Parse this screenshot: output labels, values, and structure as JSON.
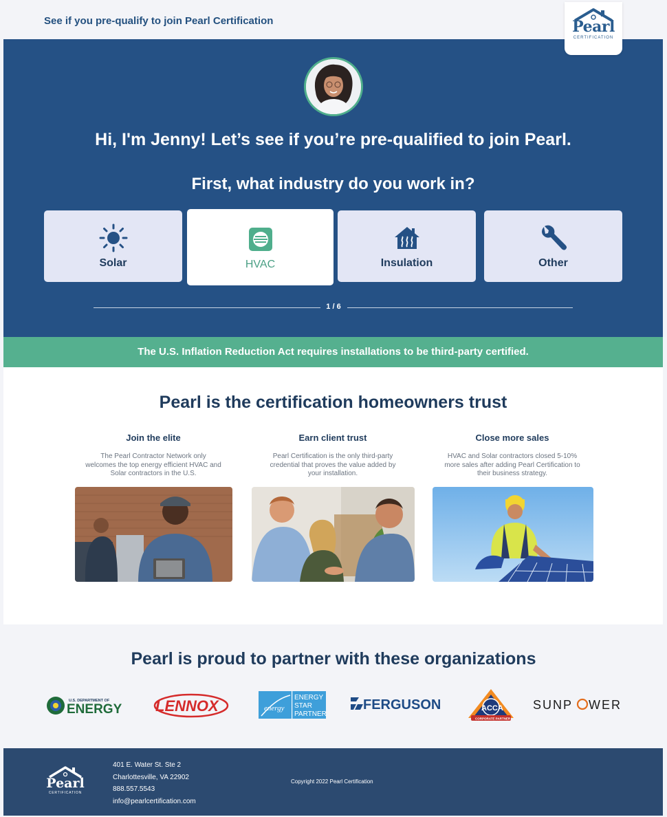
{
  "header": {
    "link_text": "See if you pre-qualify to join Pearl Certification",
    "logo_text": "Pearl",
    "logo_subtext": "CERTIFICATION"
  },
  "hero": {
    "title": "Hi, I'm Jenny! Let’s see if you’re pre-qualified to join Pearl.",
    "question": "First, what industry do you work in?",
    "options": [
      {
        "label": "Solar",
        "icon": "sun-icon",
        "selected": false
      },
      {
        "label": "HVAC",
        "icon": "hvac-unit-icon",
        "selected": true
      },
      {
        "label": "Insulation",
        "icon": "house-heat-icon",
        "selected": false
      },
      {
        "label": "Other",
        "icon": "wrench-icon",
        "selected": false
      }
    ],
    "progress_text": "1 / 6",
    "progress_fraction": 0.1667
  },
  "banner": {
    "text": "The U.S. Inflation Reduction Act requires installations to be third-party certified."
  },
  "trust": {
    "title": "Pearl is the certification homeowners trust",
    "columns": [
      {
        "heading": "Join the elite",
        "body": "The Pearl Contractor Network only welcomes the top energy efficient HVAC and Solar contractors in the U.S."
      },
      {
        "heading": "Earn client trust",
        "body": "Pearl Certification is the only third-party credential that proves the value added by your installation."
      },
      {
        "heading": "Close more sales",
        "body": "HVAC and Solar contractors closed 5-10% more sales after adding Pearl Certification to their business strategy."
      }
    ]
  },
  "partners": {
    "title": "Pearl is proud to partner with these organizations",
    "logos": {
      "doe_small": "U.S. DEPARTMENT OF",
      "doe_big": "ENERGY",
      "lennox": "LENNOX",
      "energystar_1": "ENERGY",
      "energystar_2": "STAR",
      "energystar_3": "PARTNER",
      "ferguson": "FERGUSON",
      "acca": "ACCA",
      "acca_sub": "CORPORATE PARTNER",
      "sunpower_1": "SUNP",
      "sunpower_2": "WER"
    }
  },
  "footer": {
    "logo_text": "Pearl",
    "logo_subtext": "CERTIFICATION",
    "address_1": "401 E. Water St. Ste 2",
    "address_2": "Charlottesville, VA 22902",
    "phone": "888.557.5543",
    "email": "info@pearlcertification.com",
    "copyright": "Copyright 2022 Pearl Certification"
  },
  "colors": {
    "navy": "#255185",
    "green": "#55b08f",
    "footer": "#2c4a70",
    "card": "#e3e6f5"
  }
}
